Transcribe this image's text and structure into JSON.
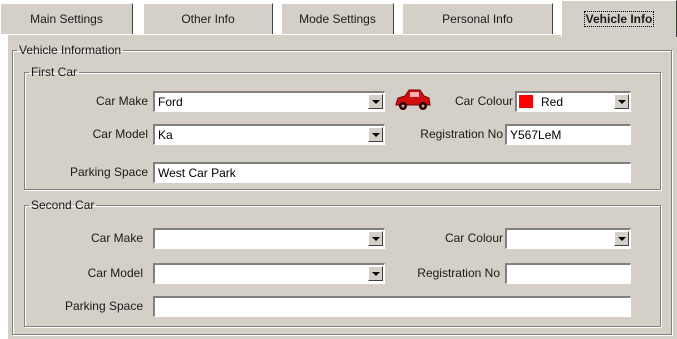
{
  "tabs": [
    {
      "label": "Main Settings"
    },
    {
      "label": "Other Info"
    },
    {
      "label": "Mode Settings"
    },
    {
      "label": "Personal Info"
    },
    {
      "label": "Vehicle Info"
    }
  ],
  "vehicle_info": {
    "title": "Vehicle Information",
    "first_car": {
      "title": "First Car",
      "make_label": "Car Make",
      "make_value": "Ford",
      "colour_label": "Car Colour",
      "colour_value": "Red",
      "colour_swatch": "#ff0000",
      "model_label": "Car Model",
      "model_value": "Ka",
      "reg_label": "Registration No",
      "reg_value": "Y567LeM",
      "parking_label": "Parking Space",
      "parking_value": "West Car Park",
      "icon": "car-icon"
    },
    "second_car": {
      "title": "Second Car",
      "make_label": "Car Make",
      "make_value": "",
      "colour_label": "Car Colour",
      "colour_value": "",
      "model_label": "Car Model",
      "model_value": "",
      "reg_label": "Registration No",
      "reg_value": "",
      "parking_label": "Parking Space",
      "parking_value": ""
    }
  },
  "colors": {
    "face": "#d4d0c8",
    "car_icon": "#d01010"
  }
}
